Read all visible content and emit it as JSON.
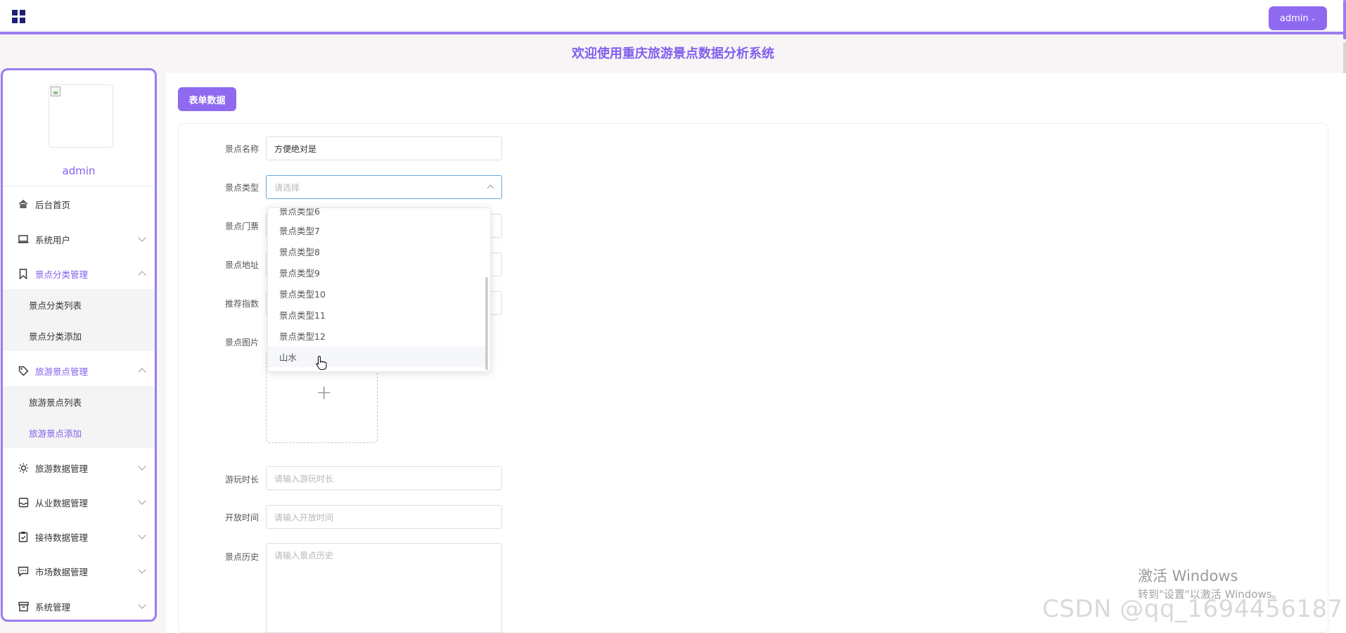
{
  "topbar": {
    "user_menu_label": "admin",
    "colors": {
      "accent": "#8f6af0",
      "border": "#9b7cf2"
    }
  },
  "header": {
    "welcome": "欢迎使用重庆旅游景点数据分析系统"
  },
  "sidebar": {
    "username": "admin",
    "items": [
      {
        "label": "后台首页",
        "icon": "home-icon"
      },
      {
        "label": "系统用户",
        "icon": "laptop-icon"
      },
      {
        "label": "景点分类管理",
        "icon": "bookmark-icon",
        "expanded": true,
        "children": [
          {
            "label": "景点分类列表"
          },
          {
            "label": "景点分类添加"
          }
        ]
      },
      {
        "label": "旅游景点管理",
        "icon": "tag-icon",
        "expanded": true,
        "children": [
          {
            "label": "旅游景点列表"
          },
          {
            "label": "旅游景点添加",
            "active": true
          }
        ]
      },
      {
        "label": "旅游数据管理",
        "icon": "sun-icon"
      },
      {
        "label": "从业数据管理",
        "icon": "inbox-icon"
      },
      {
        "label": "接待数据管理",
        "icon": "clipboard-icon"
      },
      {
        "label": "市场数据管理",
        "icon": "chat-icon"
      },
      {
        "label": "系统管理",
        "icon": "archive-icon"
      }
    ]
  },
  "main": {
    "form_data_button": "表单数据",
    "form": {
      "name": {
        "label": "景点名称",
        "value": "方便绝对是"
      },
      "type": {
        "label": "景点类型",
        "placeholder": "请选择"
      },
      "ticket": {
        "label": "景点门票"
      },
      "address": {
        "label": "景点地址"
      },
      "rating": {
        "label": "推荐指数"
      },
      "image": {
        "label": "景点图片"
      },
      "duration": {
        "label": "游玩时长",
        "placeholder": "请输入游玩时长"
      },
      "open_time": {
        "label": "开放时间",
        "placeholder": "请输入开放时间"
      },
      "history": {
        "label": "景点历史",
        "placeholder": "请输入景点历史"
      }
    },
    "dropdown_options": [
      "景点类型6",
      "景点类型7",
      "景点类型8",
      "景点类型9",
      "景点类型10",
      "景点类型11",
      "景点类型12",
      "山水"
    ]
  },
  "watermark": {
    "line1": "激活 Windows",
    "line2": "转到\"设置\"以激活 Windows。",
    "csdn": "CSDN @qq_1694456187"
  }
}
